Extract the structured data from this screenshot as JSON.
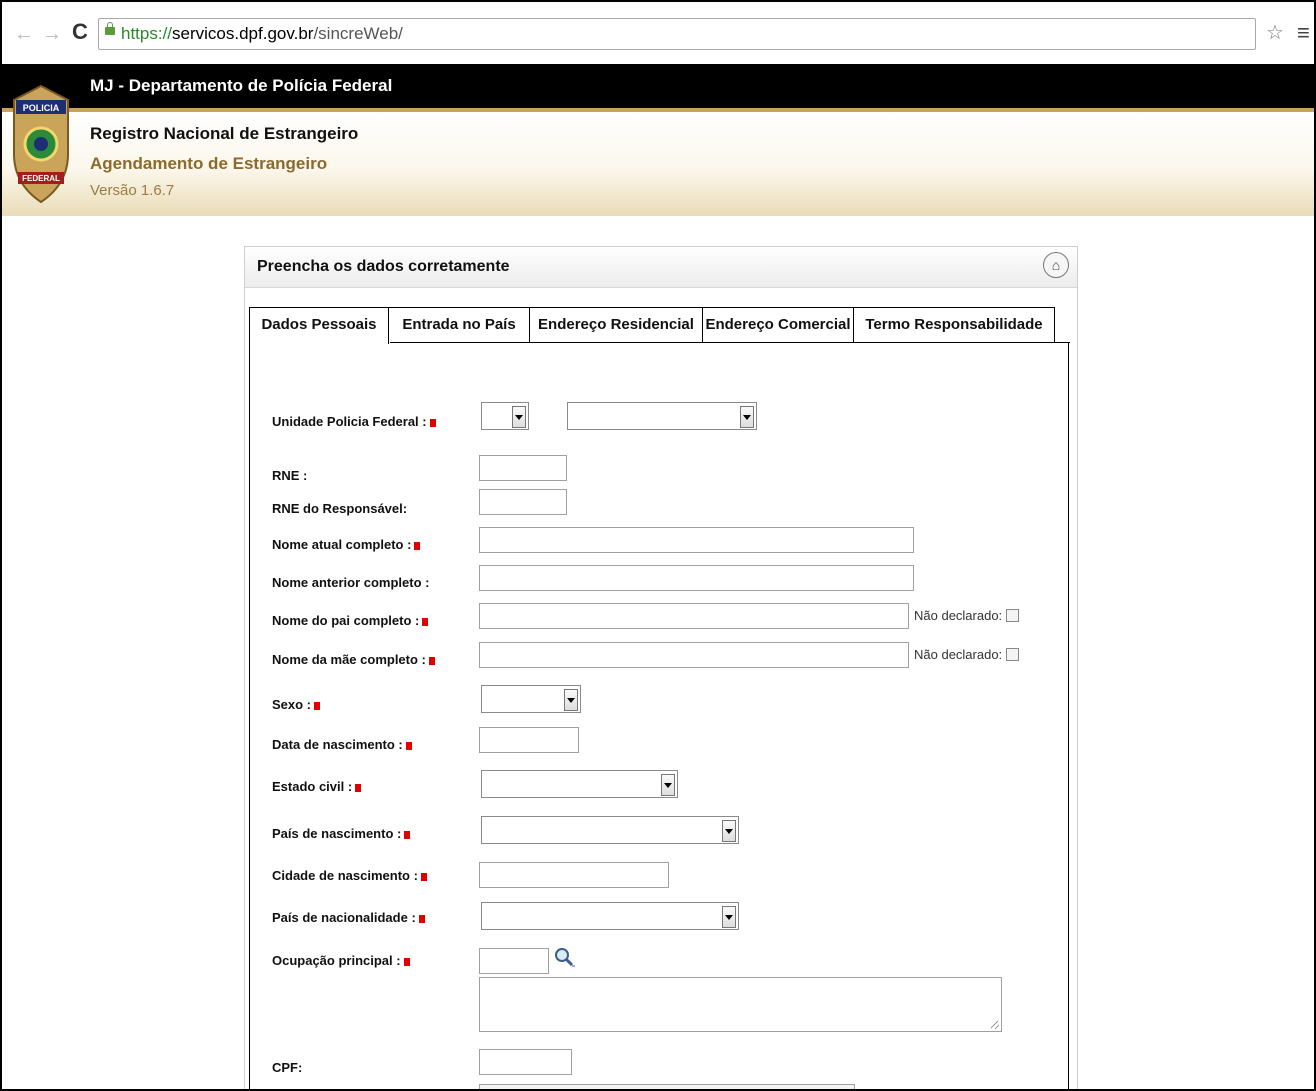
{
  "browser": {
    "url_scheme": "https://",
    "url_host": "servicos.dpf.gov.br",
    "url_path": "/sincreWeb/"
  },
  "header": {
    "title": "MJ - Departamento de Polícia Federal",
    "subtitle_1": "Registro Nacional de Estrangeiro",
    "subtitle_2": "Agendamento de Estrangeiro",
    "version": "Versão 1.6.7",
    "badge_top": "POLICIA",
    "badge_bottom": "FEDERAL"
  },
  "panel": {
    "title": "Preencha os dados corretamente"
  },
  "tabs": [
    {
      "label": "Dados Pessoais"
    },
    {
      "label": "Entrada no País"
    },
    {
      "label": "Endereço Residencial"
    },
    {
      "label": "Endereço Comercial"
    },
    {
      "label": "Termo Responsabilidade"
    }
  ],
  "form": {
    "unidade_label": "Unidade Policia Federal :",
    "rne_label": "RNE :",
    "rne_resp_label": "RNE do Responsável:",
    "nome_atual_label": "Nome atual completo :",
    "nome_anterior_label": "Nome anterior completo :",
    "nome_pai_label": "Nome do pai completo :",
    "nome_mae_label": "Nome da mãe completo :",
    "sexo_label": "Sexo :",
    "data_nasc_label": "Data de nascimento :",
    "estado_civil_label": "Estado civil :",
    "pais_nasc_label": "País de nascimento :",
    "cidade_nasc_label": "Cidade de nascimento :",
    "pais_nac_label": "País de nacionalidade :",
    "ocupacao_label": "Ocupação principal :",
    "cpf_label": "CPF:",
    "nao_declarado_pai": "Não declarado:",
    "nao_declarado_mae": "Não declarado:"
  }
}
